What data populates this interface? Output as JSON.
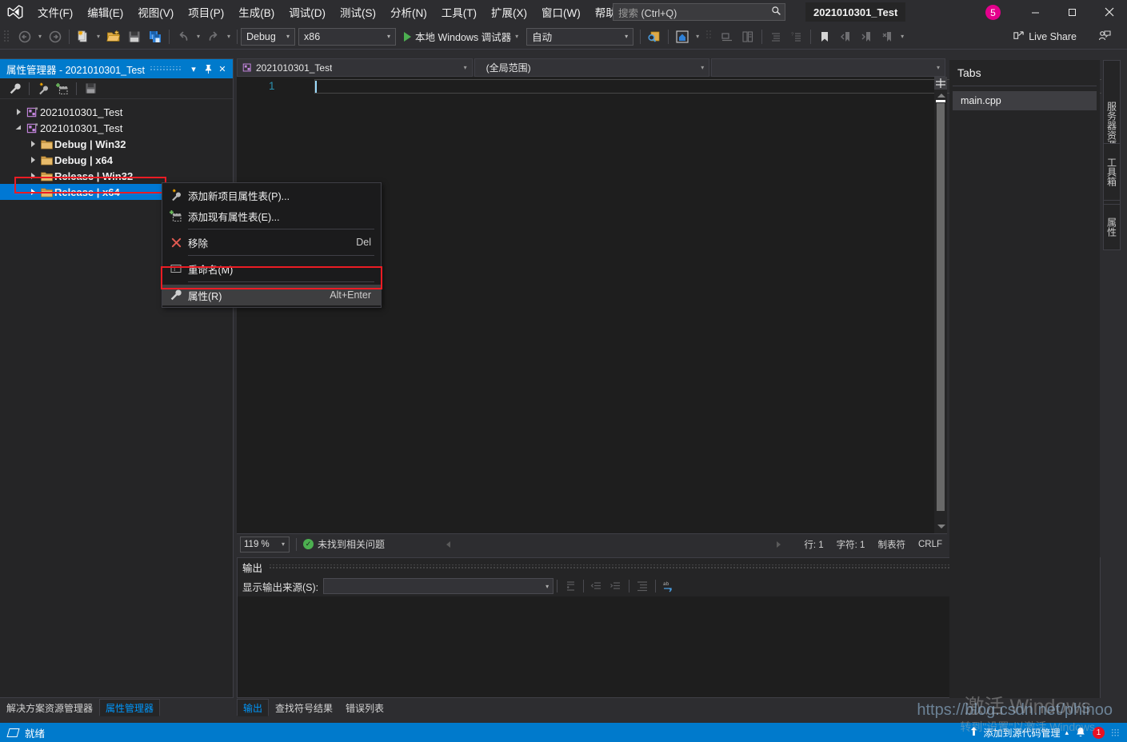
{
  "app": {
    "window_title": "2021010301_Test",
    "logo_icon": "visual-studio-logo"
  },
  "menubar": {
    "items": [
      {
        "label": "文件(F)",
        "name": "menu-file"
      },
      {
        "label": "编辑(E)",
        "name": "menu-edit"
      },
      {
        "label": "视图(V)",
        "name": "menu-view"
      },
      {
        "label": "项目(P)",
        "name": "menu-project"
      },
      {
        "label": "生成(B)",
        "name": "menu-build"
      },
      {
        "label": "调试(D)",
        "name": "menu-debug"
      },
      {
        "label": "测试(S)",
        "name": "menu-test"
      },
      {
        "label": "分析(N)",
        "name": "menu-analyze"
      },
      {
        "label": "工具(T)",
        "name": "menu-tools"
      },
      {
        "label": "扩展(X)",
        "name": "menu-extensions"
      },
      {
        "label": "窗口(W)",
        "name": "menu-window"
      },
      {
        "label": "帮助(H)",
        "name": "menu-help"
      }
    ]
  },
  "search": {
    "placeholder_main": "搜索",
    "placeholder_hint": "(Ctrl+Q)",
    "icon": "search-icon"
  },
  "titlebar_buttons": {
    "avatar_count": "5",
    "minimize": "─",
    "maximize": "□",
    "close": "✕"
  },
  "toolbar": {
    "config_combo": "Debug",
    "platform_combo": "x86",
    "run_label": "本地 Windows 调试器",
    "auto_combo": "自动",
    "live_share": "Live Share"
  },
  "property_manager": {
    "title": "属性管理器 - 2021010301_Test",
    "buttons": {
      "dropdown": "▾",
      "pin": "pin-icon",
      "close": "✕"
    },
    "toolbar_icons": [
      "properties-wrench-icon",
      "add-new-property-sheet-icon",
      "add-existing-property-sheet-icon",
      "save-icon"
    ],
    "tree": [
      {
        "label": "2021010301_Test",
        "depth": 0,
        "icon": "solution-icon",
        "expanded": false,
        "bold": false,
        "selected": false
      },
      {
        "label": "2021010301_Test",
        "depth": 0,
        "icon": "project-icon",
        "expanded": true,
        "bold": false,
        "selected": false
      },
      {
        "label": "Debug | Win32",
        "depth": 1,
        "icon": "folder-icon",
        "expanded": false,
        "bold": true,
        "selected": false
      },
      {
        "label": "Debug | x64",
        "depth": 1,
        "icon": "folder-icon",
        "expanded": false,
        "bold": true,
        "selected": false
      },
      {
        "label": "Release | Win32",
        "depth": 1,
        "icon": "folder-icon",
        "expanded": false,
        "bold": true,
        "selected": false
      },
      {
        "label": "Release | x64",
        "depth": 1,
        "icon": "folder-icon",
        "expanded": false,
        "bold": true,
        "selected": true
      }
    ]
  },
  "context_menu": {
    "items": [
      {
        "label": "添加新项目属性表(P)...",
        "shortcut": "",
        "icon": "add-new-property-sheet-icon",
        "highlighted": false,
        "name": "ctx-add-new-property-sheet"
      },
      {
        "label": "添加现有属性表(E)...",
        "shortcut": "",
        "icon": "add-existing-property-sheet-icon",
        "highlighted": false,
        "name": "ctx-add-existing-property-sheet"
      },
      {
        "label": "移除",
        "shortcut": "Del",
        "icon": "remove-x-icon",
        "highlighted": false,
        "name": "ctx-remove"
      },
      {
        "label": "重命名(M)",
        "shortcut": "",
        "icon": "rename-icon",
        "highlighted": false,
        "name": "ctx-rename"
      },
      {
        "label": "属性(R)",
        "shortcut": "Alt+Enter",
        "icon": "properties-wrench-icon",
        "highlighted": true,
        "name": "ctx-properties"
      }
    ]
  },
  "editor": {
    "project_dropdown": "2021010301_Test",
    "scope_dropdown": "(全局范围)",
    "member_dropdown": "",
    "line_number": "1",
    "code_text": "",
    "status": {
      "zoom": "119 %",
      "issues": "未找到相关问题",
      "line_label": "行: 1",
      "char_label": "字符: 1",
      "tabs_label": "制表符",
      "eol_label": "CRLF"
    }
  },
  "output_panel": {
    "title": "输出",
    "source_label": "显示输出来源(S):",
    "source_value": "",
    "buttons": {
      "dropdown": "▾",
      "pin": "pin-icon",
      "close": "✕"
    },
    "toolbar_icons": [
      "find-message-icon",
      "clear-all-icon",
      "go-to-next-icon",
      "toggle-wordwrap-icon",
      "toggle-autoscroll-icon"
    ]
  },
  "bottom_tabs": {
    "left": [
      {
        "label": "解决方案资源管理器",
        "active": false,
        "name": "tab-solution-explorer"
      },
      {
        "label": "属性管理器",
        "active": true,
        "name": "tab-property-manager"
      }
    ],
    "output": [
      {
        "label": "输出",
        "active": true,
        "name": "tab-output"
      },
      {
        "label": "查找符号结果",
        "active": false,
        "name": "tab-find-symbol-results"
      },
      {
        "label": "错误列表",
        "active": false,
        "name": "tab-error-list"
      }
    ]
  },
  "tabs_panel": {
    "title": "Tabs",
    "items": [
      {
        "label": "main.cpp",
        "selected": true
      }
    ]
  },
  "vertical_dock_tabs": [
    {
      "label": "服务器资源管理器",
      "name": "vtab-server-explorer"
    },
    {
      "label": "工具箱",
      "name": "vtab-toolbox"
    },
    {
      "label": "属性",
      "name": "vtab-properties"
    }
  ],
  "statusbar": {
    "ready": "就绪",
    "source_control": "添加到源代码管理",
    "notification_count": "1"
  },
  "watermark": {
    "activate_line1": "激活 Windows",
    "activate_line2": "转到\"设置\"以激活 Windows",
    "url": "https://blog.csdn.net/phinoo"
  },
  "colors": {
    "accent_blue": "#007acc",
    "selection_blue": "#0078d4",
    "highlight_red": "#ec1c24",
    "chrome_bg": "#2d2d30",
    "panel_bg": "#252526",
    "editor_bg": "#1e1e1e",
    "avatar_magenta": "#e3008c",
    "badge_red": "#e81123"
  }
}
